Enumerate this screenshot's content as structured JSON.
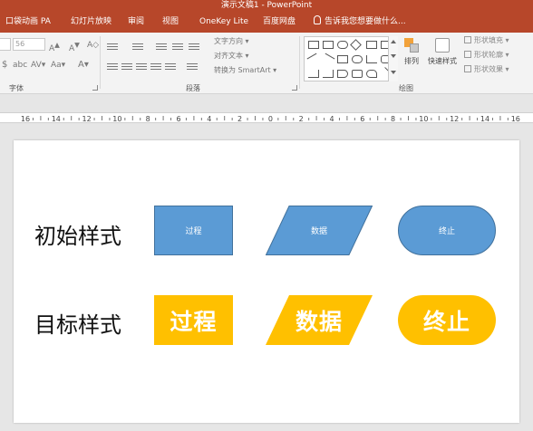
{
  "window": {
    "title": "演示文稿1 - PowerPoint",
    "accent": "#b7472a"
  },
  "tabs": [
    {
      "label": "口袋动画 PA"
    },
    {
      "label": "幻灯片放映"
    },
    {
      "label": "审阅"
    },
    {
      "label": "视图"
    },
    {
      "label": "OneKey Lite"
    },
    {
      "label": "百度网盘"
    }
  ],
  "tell_me": {
    "icon": "lightbulb-icon",
    "placeholder": "告诉我您想要做什么..."
  },
  "ribbon": {
    "font_size_value": "56",
    "font_group": "字体",
    "paragraph_group": "段落",
    "drawing_group": "绘图",
    "text_direction": "文字方向",
    "align_text": "对齐文本",
    "convert_smartart": "转换为 SmartArt",
    "arrange": "排列",
    "quick_styles": "快速样式",
    "shape_fill": "形状填充",
    "shape_outline": "形状轮廓",
    "shape_effects": "形状效果"
  },
  "ruler": {
    "labels": [
      "16",
      "14",
      "12",
      "10",
      "8",
      "6",
      "4",
      "2",
      "0",
      "2",
      "4",
      "6",
      "8",
      "10",
      "12",
      "14",
      "16"
    ]
  },
  "slide": {
    "rows": [
      {
        "label": "初始样式",
        "shapes": [
          {
            "kind": "process",
            "text": "过程",
            "fill": "#5b9bd5"
          },
          {
            "kind": "data",
            "text": "数据",
            "fill": "#5b9bd5"
          },
          {
            "kind": "terminator",
            "text": "终止",
            "fill": "#5b9bd5"
          }
        ]
      },
      {
        "label": "目标样式",
        "shapes": [
          {
            "kind": "process",
            "text": "过程",
            "fill": "#ffc000"
          },
          {
            "kind": "data",
            "text": "数据",
            "fill": "#ffc000"
          },
          {
            "kind": "terminator",
            "text": "终止",
            "fill": "#ffc000"
          }
        ]
      }
    ]
  }
}
